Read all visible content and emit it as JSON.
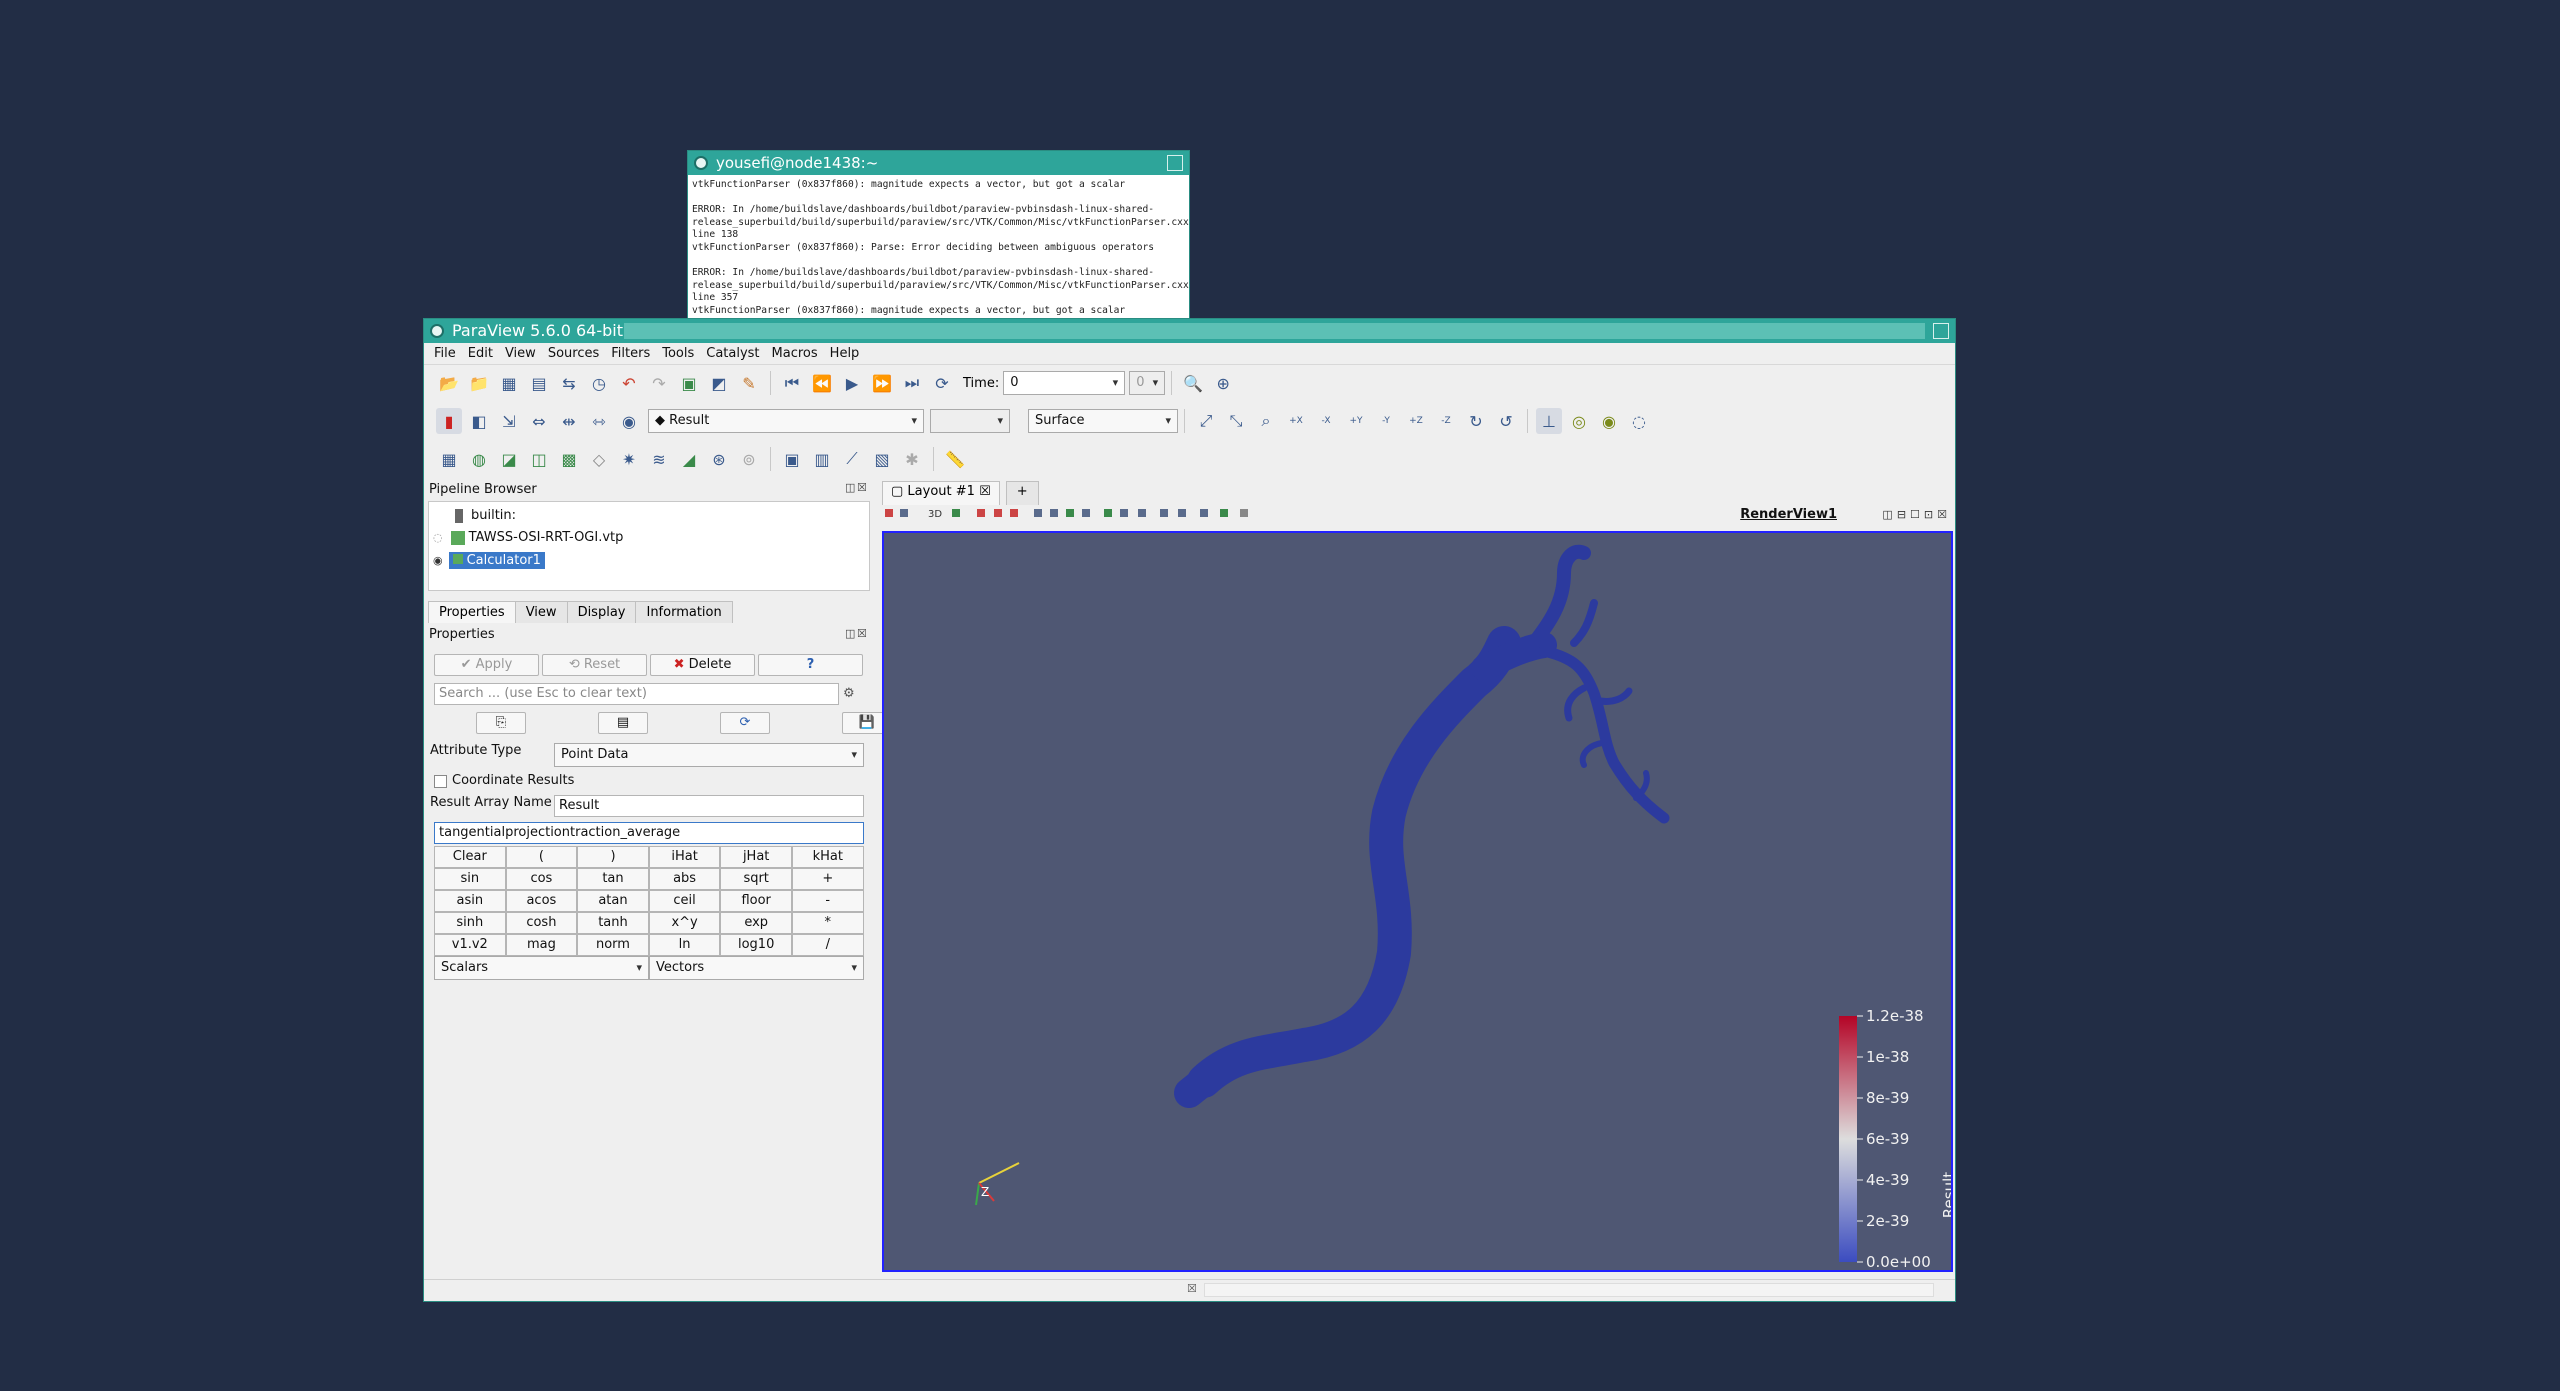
{
  "terminal": {
    "title": "yousefi@node1438:~",
    "text": "vtkFunctionParser (0x837f860): magnitude expects a vector, but got a scalar\n\nERROR: In /home/buildslave/dashboards/buildbot/paraview-pvbinsdash-linux-shared-release_superbuild/build/superbuild/paraview/src/VTK/Common/Misc/vtkFunctionParser.cxx, line 138\nvtkFunctionParser (0x837f860): Parse: Error deciding between ambiguous operators\n\nERROR: In /home/buildslave/dashboards/buildbot/paraview-pvbinsdash-linux-shared-release_superbuild/build/superbuild/paraview/src/VTK/Common/Misc/vtkFunctionParser.cxx, line 357\nvtkFunctionParser (0x837f860): magnitude expects a vector, but got a scalar"
  },
  "window": {
    "title": "ParaView 5.6.0 64-bit"
  },
  "menu": [
    "File",
    "Edit",
    "View",
    "Sources",
    "Filters",
    "Tools",
    "Catalyst",
    "Macros",
    "Help"
  ],
  "toolbar": {
    "time_label": "Time:",
    "time_value": "0",
    "time_index": "0",
    "color_by": "Result",
    "component": "",
    "representation": "Surface"
  },
  "pipeline": {
    "title": "Pipeline Browser",
    "items": [
      "builtin:",
      "TAWSS-OSI-RRT-OGI.vtp",
      "Calculator1"
    ]
  },
  "tabs": [
    "Properties",
    "View",
    "Display",
    "Information"
  ],
  "properties": {
    "title": "Properties",
    "apply": "Apply",
    "reset": "Reset",
    "delete": "Delete",
    "help": "?",
    "search_placeholder": "Search ... (use Esc to clear text)",
    "attribute_type_label": "Attribute Type",
    "attribute_type_value": "Point Data",
    "coordinate_results_label": "Coordinate Results",
    "result_array_label": "Result Array Name",
    "result_array_value": "Result",
    "expression": "tangentialprojectiontraction_average",
    "keypad": [
      "Clear",
      "(",
      ")",
      "iHat",
      "jHat",
      "kHat",
      "sin",
      "cos",
      "tan",
      "abs",
      "sqrt",
      "+",
      "asin",
      "acos",
      "atan",
      "ceil",
      "floor",
      "-",
      "sinh",
      "cosh",
      "tanh",
      "x^y",
      "exp",
      "*",
      "v1.v2",
      "mag",
      "norm",
      "ln",
      "log10",
      "/"
    ],
    "scalars": "Scalars",
    "vectors": "Vectors"
  },
  "layout": {
    "tab": "Layout #1",
    "plus": "+",
    "view_name": "RenderView1",
    "view_3d": "3D"
  },
  "colorbar": {
    "title": "Result",
    "ticks": [
      "1.2e-38",
      "1e-38",
      "8e-39",
      "6e-39",
      "4e-39",
      "2e-39",
      "0.0e+00"
    ],
    "colors": {
      "low": "#3b4cc0",
      "mid": "#dddddd",
      "high": "#b40426"
    }
  },
  "axes": {
    "z_label": "Z"
  },
  "colors": {
    "desktop": "#222d45",
    "titlebar": "#2ea59a",
    "render_bg": "#4f5773",
    "vessel": "#2c3a9e",
    "selection": "#3a79c9"
  }
}
